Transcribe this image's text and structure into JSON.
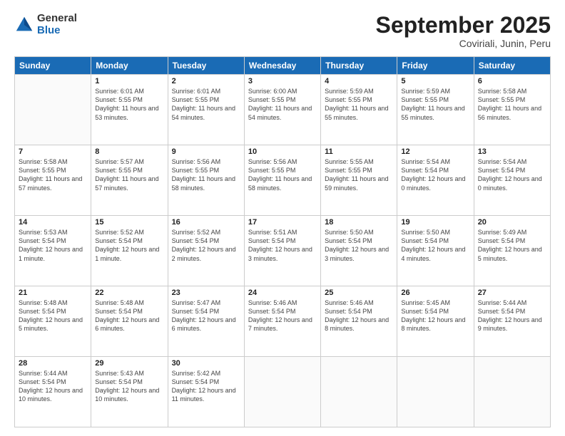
{
  "logo": {
    "general": "General",
    "blue": "Blue"
  },
  "title": "September 2025",
  "location": "Coviriali, Junin, Peru",
  "days_of_week": [
    "Sunday",
    "Monday",
    "Tuesday",
    "Wednesday",
    "Thursday",
    "Friday",
    "Saturday"
  ],
  "weeks": [
    [
      {
        "day": "",
        "info": ""
      },
      {
        "day": "1",
        "info": "Sunrise: 6:01 AM\nSunset: 5:55 PM\nDaylight: 11 hours\nand 53 minutes."
      },
      {
        "day": "2",
        "info": "Sunrise: 6:01 AM\nSunset: 5:55 PM\nDaylight: 11 hours\nand 54 minutes."
      },
      {
        "day": "3",
        "info": "Sunrise: 6:00 AM\nSunset: 5:55 PM\nDaylight: 11 hours\nand 54 minutes."
      },
      {
        "day": "4",
        "info": "Sunrise: 5:59 AM\nSunset: 5:55 PM\nDaylight: 11 hours\nand 55 minutes."
      },
      {
        "day": "5",
        "info": "Sunrise: 5:59 AM\nSunset: 5:55 PM\nDaylight: 11 hours\nand 55 minutes."
      },
      {
        "day": "6",
        "info": "Sunrise: 5:58 AM\nSunset: 5:55 PM\nDaylight: 11 hours\nand 56 minutes."
      }
    ],
    [
      {
        "day": "7",
        "info": "Sunrise: 5:58 AM\nSunset: 5:55 PM\nDaylight: 11 hours\nand 57 minutes."
      },
      {
        "day": "8",
        "info": "Sunrise: 5:57 AM\nSunset: 5:55 PM\nDaylight: 11 hours\nand 57 minutes."
      },
      {
        "day": "9",
        "info": "Sunrise: 5:56 AM\nSunset: 5:55 PM\nDaylight: 11 hours\nand 58 minutes."
      },
      {
        "day": "10",
        "info": "Sunrise: 5:56 AM\nSunset: 5:55 PM\nDaylight: 11 hours\nand 58 minutes."
      },
      {
        "day": "11",
        "info": "Sunrise: 5:55 AM\nSunset: 5:55 PM\nDaylight: 11 hours\nand 59 minutes."
      },
      {
        "day": "12",
        "info": "Sunrise: 5:54 AM\nSunset: 5:54 PM\nDaylight: 12 hours\nand 0 minutes."
      },
      {
        "day": "13",
        "info": "Sunrise: 5:54 AM\nSunset: 5:54 PM\nDaylight: 12 hours\nand 0 minutes."
      }
    ],
    [
      {
        "day": "14",
        "info": "Sunrise: 5:53 AM\nSunset: 5:54 PM\nDaylight: 12 hours\nand 1 minute."
      },
      {
        "day": "15",
        "info": "Sunrise: 5:52 AM\nSunset: 5:54 PM\nDaylight: 12 hours\nand 1 minute."
      },
      {
        "day": "16",
        "info": "Sunrise: 5:52 AM\nSunset: 5:54 PM\nDaylight: 12 hours\nand 2 minutes."
      },
      {
        "day": "17",
        "info": "Sunrise: 5:51 AM\nSunset: 5:54 PM\nDaylight: 12 hours\nand 3 minutes."
      },
      {
        "day": "18",
        "info": "Sunrise: 5:50 AM\nSunset: 5:54 PM\nDaylight: 12 hours\nand 3 minutes."
      },
      {
        "day": "19",
        "info": "Sunrise: 5:50 AM\nSunset: 5:54 PM\nDaylight: 12 hours\nand 4 minutes."
      },
      {
        "day": "20",
        "info": "Sunrise: 5:49 AM\nSunset: 5:54 PM\nDaylight: 12 hours\nand 5 minutes."
      }
    ],
    [
      {
        "day": "21",
        "info": "Sunrise: 5:48 AM\nSunset: 5:54 PM\nDaylight: 12 hours\nand 5 minutes."
      },
      {
        "day": "22",
        "info": "Sunrise: 5:48 AM\nSunset: 5:54 PM\nDaylight: 12 hours\nand 6 minutes."
      },
      {
        "day": "23",
        "info": "Sunrise: 5:47 AM\nSunset: 5:54 PM\nDaylight: 12 hours\nand 6 minutes."
      },
      {
        "day": "24",
        "info": "Sunrise: 5:46 AM\nSunset: 5:54 PM\nDaylight: 12 hours\nand 7 minutes."
      },
      {
        "day": "25",
        "info": "Sunrise: 5:46 AM\nSunset: 5:54 PM\nDaylight: 12 hours\nand 8 minutes."
      },
      {
        "day": "26",
        "info": "Sunrise: 5:45 AM\nSunset: 5:54 PM\nDaylight: 12 hours\nand 8 minutes."
      },
      {
        "day": "27",
        "info": "Sunrise: 5:44 AM\nSunset: 5:54 PM\nDaylight: 12 hours\nand 9 minutes."
      }
    ],
    [
      {
        "day": "28",
        "info": "Sunrise: 5:44 AM\nSunset: 5:54 PM\nDaylight: 12 hours\nand 10 minutes."
      },
      {
        "day": "29",
        "info": "Sunrise: 5:43 AM\nSunset: 5:54 PM\nDaylight: 12 hours\nand 10 minutes."
      },
      {
        "day": "30",
        "info": "Sunrise: 5:42 AM\nSunset: 5:54 PM\nDaylight: 12 hours\nand 11 minutes."
      },
      {
        "day": "",
        "info": ""
      },
      {
        "day": "",
        "info": ""
      },
      {
        "day": "",
        "info": ""
      },
      {
        "day": "",
        "info": ""
      }
    ]
  ]
}
